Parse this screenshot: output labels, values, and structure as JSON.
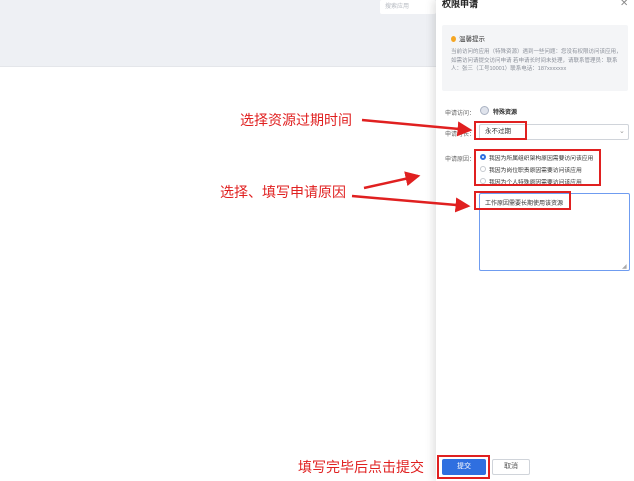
{
  "background": {
    "search_placeholder": "搜索应用"
  },
  "drawer": {
    "title": "权限申请",
    "close_icon": "close-icon",
    "tip": {
      "title": "温馨提示",
      "body": "当前访问的应用（特殊资源）遇到一些问题：您没有权限访问该应用，如需访问请提交访问申请 若申请长时间未处理，请联系管理员：联系人：张三（工号10001）联系电话：187xxxxxxx"
    },
    "form": {
      "access_label": "申请访问：",
      "access_value": "特殊资源",
      "duration_label": "申请时长：",
      "duration_value": "永不过期",
      "reason_label": "申请原因：",
      "reasons": [
        {
          "label": "我因为所属组织架构原因需要访问该应用",
          "selected": true
        },
        {
          "label": "我因为岗位职责原因需要访问该应用",
          "selected": false
        },
        {
          "label": "我因为个人特殊原因需要访问该应用",
          "selected": false
        }
      ],
      "reason_text": "工作原因需要长期使用该资源"
    },
    "buttons": {
      "submit": "提交",
      "cancel": "取消"
    }
  },
  "annotations": {
    "select_expiry": "选择资源过期时间",
    "fill_reason": "选择、填写申请原因",
    "click_submit": "填写完毕后点击提交"
  },
  "colors": {
    "annotation": "#e02020",
    "primary": "#2f6fe0",
    "tip_dot": "#f5a623"
  }
}
